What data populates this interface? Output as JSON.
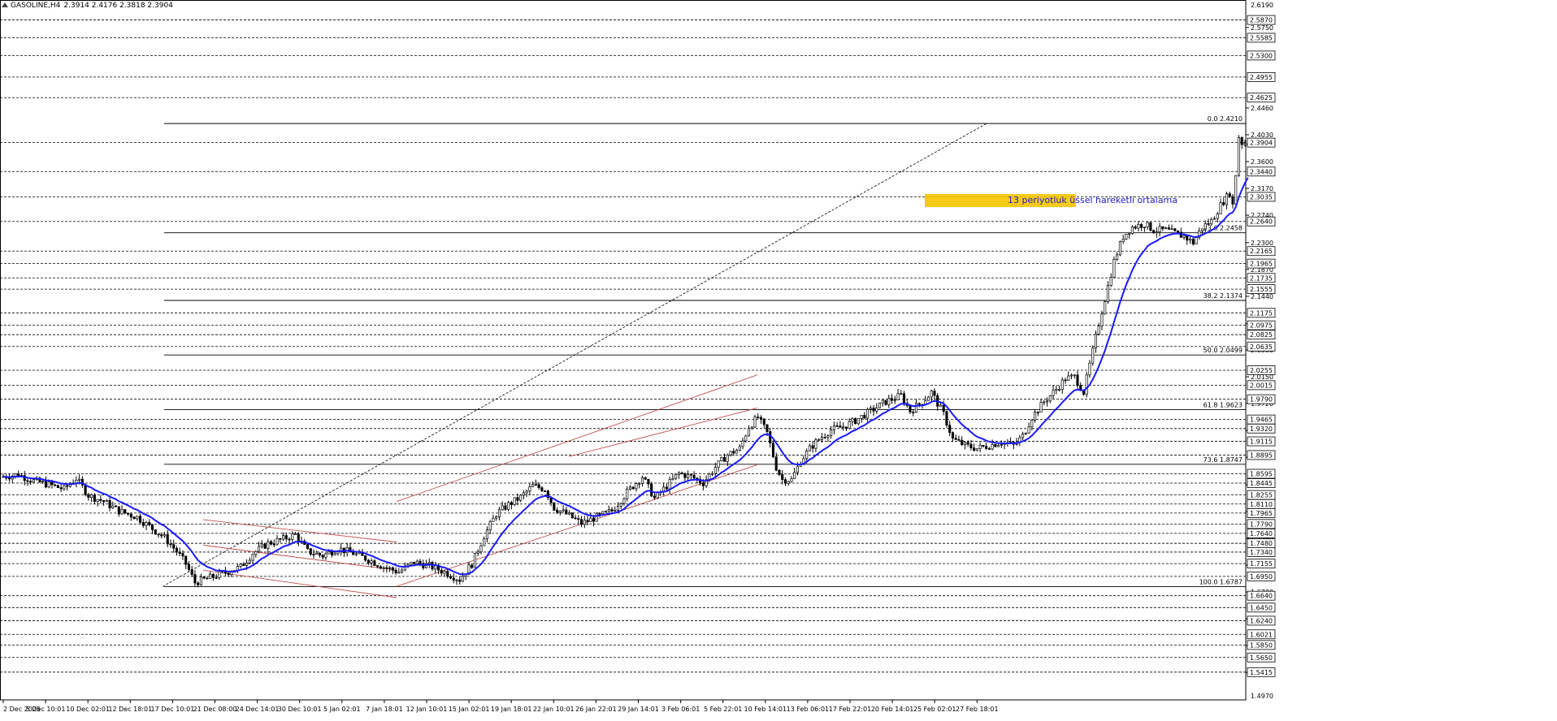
{
  "header": {
    "symbol_timeframe": "GASOLINE,H4",
    "ohlc": "2.3914 2.4176 2.3818 2.3904"
  },
  "annotation": {
    "ema_label": "13 periyotluk üssel hareketli ortalama"
  },
  "colors": {
    "candles": "#000000",
    "ema": "#1a1aff",
    "channel": "#c0504d",
    "fib": "#000000",
    "zone": "#f5c400",
    "ema_label": "#2020c8"
  },
  "price_axis": {
    "top_label": "2.6190",
    "bottom_label": "1.4970",
    "plain_ticks": [
      "2.5750",
      "2.4460",
      "2.4030",
      "2.3600",
      "2.3170",
      "2.2740",
      "2.2300",
      "2.1870",
      "2.1440",
      "2.1000",
      "2.0580",
      "2.0150",
      "1.9720",
      "1.9290",
      "1.8860",
      "1.8420",
      "1.7990",
      "1.7560",
      "1.7130",
      "1.6700",
      "1.6270",
      "1.5840",
      "1.5410"
    ],
    "boxed_levels": [
      "2.5870",
      "2.5585",
      "2.5300",
      "2.4955",
      "2.4625",
      "2.3904",
      "2.3440",
      "2.3035",
      "2.2640",
      "2.2165",
      "2.1965",
      "2.1735",
      "2.1555",
      "2.1175",
      "2.0975",
      "2.0825",
      "2.0635",
      "2.0255",
      "2.0015",
      "1.9790",
      "1.9465",
      "1.9320",
      "1.9115",
      "1.8895",
      "1.8595",
      "1.8445",
      "1.8255",
      "1.8110",
      "1.7965",
      "1.7790",
      "1.7640",
      "1.7480",
      "1.7340",
      "1.7155",
      "1.6950",
      "1.6640",
      "1.6450",
      "1.6240",
      "1.6021",
      "1.5850",
      "1.5650",
      "1.5415"
    ]
  },
  "time_axis": [
    "2 Dec 2025",
    "5 Dec 10:01",
    "10 Dec 02:01",
    "12 Dec 18:01",
    "17 Dec 10:01",
    "21 Dec 08:00",
    "24 Dec 14:01",
    "30 Dec 10:01",
    "5 Jan 02:01",
    "7 Jan 18:01",
    "12 Jan 10:01",
    "15 Jan 02:01",
    "19 Jan 18:01",
    "22 Jan 10:01",
    "26 Jan 22:01",
    "29 Jan 14:01",
    "3 Feb 06:01",
    "5 Feb 22:01",
    "10 Feb 14:01",
    "13 Feb 06:01",
    "17 Feb 22:01",
    "20 Feb 14:01",
    "25 Feb 02:01",
    "27 Feb 18:01"
  ],
  "fibonacci": [
    {
      "label": "0.0 2.4210",
      "level": 2.421
    },
    {
      "label": "23.6 2.2458",
      "level": 2.2458
    },
    {
      "label": "38.2 2.1374",
      "level": 2.1374
    },
    {
      "label": "50.0 2.0499",
      "level": 2.0499
    },
    {
      "label": "61.8 1.9623",
      "level": 1.9623
    },
    {
      "label": "73.6 1.8747",
      "level": 1.8747
    },
    {
      "label": "100.0 1.6787",
      "level": 1.6787
    }
  ],
  "chart_data": {
    "type": "candlestick",
    "instrument": "GASOLINE",
    "timeframe": "H4",
    "last_price": 2.3904,
    "y_range": [
      1.497,
      2.619
    ],
    "price_path": [
      [
        0,
        1.855
      ],
      [
        5,
        1.858
      ],
      [
        10,
        1.848
      ],
      [
        15,
        1.842
      ],
      [
        20,
        1.835
      ],
      [
        24,
        1.852
      ],
      [
        28,
        1.825
      ],
      [
        33,
        1.815
      ],
      [
        38,
        1.8
      ],
      [
        44,
        1.79
      ],
      [
        48,
        1.775
      ],
      [
        53,
        1.757
      ],
      [
        57,
        1.735
      ],
      [
        60,
        1.715
      ],
      [
        63,
        1.685
      ],
      [
        66,
        1.69
      ],
      [
        70,
        1.696
      ],
      [
        74,
        1.703
      ],
      [
        78,
        1.71
      ],
      [
        82,
        1.732
      ],
      [
        87,
        1.748
      ],
      [
        92,
        1.755
      ],
      [
        96,
        1.762
      ],
      [
        100,
        1.735
      ],
      [
        105,
        1.728
      ],
      [
        110,
        1.74
      ],
      [
        115,
        1.732
      ],
      [
        120,
        1.722
      ],
      [
        125,
        1.71
      ],
      [
        130,
        1.702
      ],
      [
        135,
        1.718
      ],
      [
        140,
        1.712
      ],
      [
        145,
        1.702
      ],
      [
        150,
        1.69
      ],
      [
        154,
        1.715
      ],
      [
        158,
        1.76
      ],
      [
        162,
        1.795
      ],
      [
        166,
        1.81
      ],
      [
        170,
        1.822
      ],
      [
        174,
        1.84
      ],
      [
        178,
        1.835
      ],
      [
        181,
        1.805
      ],
      [
        185,
        1.795
      ],
      [
        190,
        1.78
      ],
      [
        195,
        1.79
      ],
      [
        200,
        1.8
      ],
      [
        205,
        1.83
      ],
      [
        210,
        1.855
      ],
      [
        214,
        1.82
      ],
      [
        218,
        1.84
      ],
      [
        222,
        1.86
      ],
      [
        226,
        1.855
      ],
      [
        230,
        1.845
      ],
      [
        234,
        1.87
      ],
      [
        238,
        1.89
      ],
      [
        242,
        1.9
      ],
      [
        245,
        1.935
      ],
      [
        248,
        1.95
      ],
      [
        251,
        1.925
      ],
      [
        254,
        1.87
      ],
      [
        256,
        1.85
      ],
      [
        259,
        1.85
      ],
      [
        262,
        1.88
      ],
      [
        265,
        1.9
      ],
      [
        268,
        1.915
      ],
      [
        272,
        1.93
      ],
      [
        276,
        1.935
      ],
      [
        280,
        1.945
      ],
      [
        285,
        1.96
      ],
      [
        290,
        1.975
      ],
      [
        295,
        1.985
      ],
      [
        298,
        1.96
      ],
      [
        302,
        1.975
      ],
      [
        305,
        1.99
      ],
      [
        309,
        1.955
      ],
      [
        312,
        1.915
      ],
      [
        316,
        1.905
      ],
      [
        320,
        1.9
      ],
      [
        324,
        1.905
      ],
      [
        328,
        1.91
      ],
      [
        332,
        1.905
      ],
      [
        335,
        1.92
      ],
      [
        338,
        1.95
      ],
      [
        342,
        1.975
      ],
      [
        346,
        1.995
      ],
      [
        349,
        2.012
      ],
      [
        352,
        2.015
      ],
      [
        355,
        1.99
      ],
      [
        360,
        2.1
      ],
      [
        365,
        2.2
      ],
      [
        368,
        2.24
      ],
      [
        371,
        2.255
      ],
      [
        375,
        2.26
      ],
      [
        378,
        2.25
      ],
      [
        382,
        2.25
      ],
      [
        385,
        2.245
      ],
      [
        388,
        2.24
      ],
      [
        391,
        2.23
      ],
      [
        394,
        2.255
      ],
      [
        397,
        2.265
      ],
      [
        400,
        2.29
      ],
      [
        403,
        2.31
      ],
      [
        404,
        2.29
      ],
      [
        405,
        2.34
      ],
      [
        406,
        2.4
      ],
      [
        407,
        2.39
      ]
    ],
    "ema13_period": 13,
    "horizontal_levels": [
      2.587,
      2.5585,
      2.53,
      2.4955,
      2.4625,
      2.3904,
      2.344,
      2.3035,
      2.264,
      2.2165,
      2.1965,
      2.1735,
      2.1555,
      2.1175,
      2.0975,
      2.0825,
      2.0635,
      2.0255,
      2.0015,
      1.979,
      1.9465,
      1.932,
      1.9115,
      1.8895,
      1.8595,
      1.8445,
      1.8255,
      1.811,
      1.7965,
      1.779,
      1.764,
      1.748,
      1.734,
      1.7155,
      1.695,
      1.664,
      1.645,
      1.624,
      1.6021,
      1.585,
      1.565,
      1.5415
    ],
    "resistance_zone": [
      2.287,
      2.308
    ]
  }
}
